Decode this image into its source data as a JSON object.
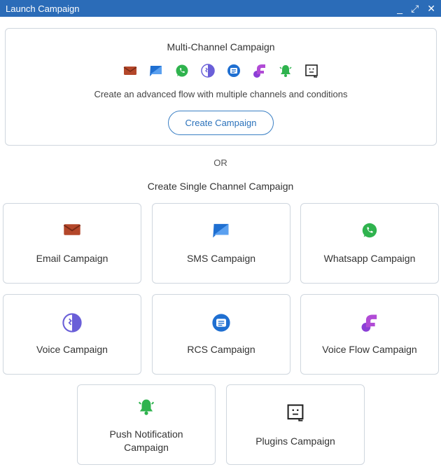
{
  "window": {
    "title": "Launch Campaign",
    "minimize_glyph": "_",
    "maximize_glyph": "⤢",
    "close_glyph": "✕"
  },
  "multi": {
    "title": "Multi-Channel Campaign",
    "channel_icons": [
      "email-icon",
      "sms-icon",
      "whatsapp-icon",
      "voice-icon",
      "rcs-icon",
      "voice-flow-icon",
      "push-notification-icon",
      "plugins-icon"
    ],
    "description": "Create an advanced flow with multiple channels and conditions",
    "button_label": "Create Campaign"
  },
  "or_text": "OR",
  "single_title": "Create Single Channel Campaign",
  "cards": [
    {
      "label": "Email Campaign",
      "icon": "email-icon"
    },
    {
      "label": "SMS Campaign",
      "icon": "sms-icon"
    },
    {
      "label": "Whatsapp Campaign",
      "icon": "whatsapp-icon"
    },
    {
      "label": "Voice Campaign",
      "icon": "voice-icon"
    },
    {
      "label": "RCS Campaign",
      "icon": "rcs-icon"
    },
    {
      "label": "Voice Flow Campaign",
      "icon": "voice-flow-icon"
    },
    {
      "label": "Push Notification Campaign",
      "icon": "push-notification-icon"
    },
    {
      "label": "Plugins Campaign",
      "icon": "plugins-icon"
    }
  ],
  "colors": {
    "titlebar": "#2b6cb8",
    "email": "#b4472a",
    "sms": "#1f6fd1",
    "whatsapp": "#2fb34e",
    "voice": "#6a5fd8",
    "rcs": "#1f6fd1",
    "voice_flow": "#8b3fd6",
    "push": "#2fb34e",
    "plugins": "#222222"
  }
}
